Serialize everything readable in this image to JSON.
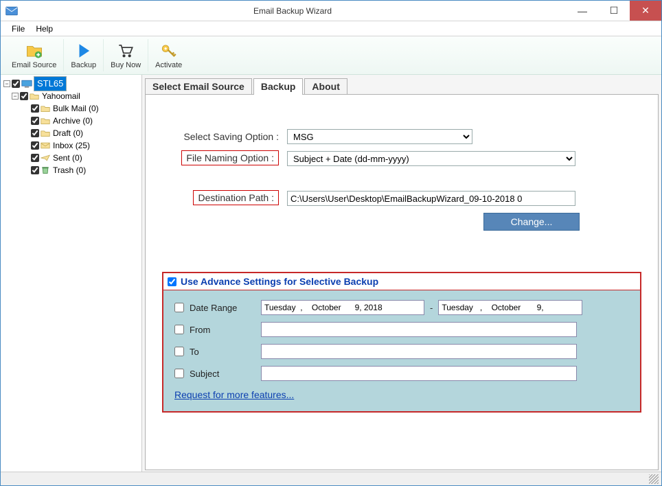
{
  "title": "Email Backup Wizard",
  "menu": {
    "file": "File",
    "help": "Help"
  },
  "toolbar": {
    "email_source": "Email Source",
    "backup": "Backup",
    "buy_now": "Buy Now",
    "activate": "Activate"
  },
  "tree": {
    "root": "STL65",
    "account": "Yahoomail",
    "folders": [
      {
        "name": "Bulk Mail (0)"
      },
      {
        "name": "Archive (0)"
      },
      {
        "name": "Draft (0)"
      },
      {
        "name": "Inbox (25)"
      },
      {
        "name": "Sent (0)"
      },
      {
        "name": "Trash (0)"
      }
    ]
  },
  "tabs": {
    "select_email_source": "Select Email Source",
    "backup": "Backup",
    "about": "About"
  },
  "form": {
    "saving_option_label": "Select Saving Option :",
    "saving_option_value": "MSG",
    "file_naming_label": "File Naming Option :",
    "file_naming_value": "Subject + Date (dd-mm-yyyy)",
    "dest_path_label": "Destination Path :",
    "dest_path_value": "C:\\Users\\User\\Desktop\\EmailBackupWizard_09-10-2018 0",
    "change_btn": "Change..."
  },
  "advance": {
    "header": "Use Advance Settings for Selective Backup",
    "date_range": "Date Range",
    "date_from": "Tuesday  ,    October      9, 2018",
    "date_to": "Tuesday   ,    October       9,",
    "from": "From",
    "to": "To",
    "subject": "Subject",
    "request_link": "Request for more features..."
  }
}
